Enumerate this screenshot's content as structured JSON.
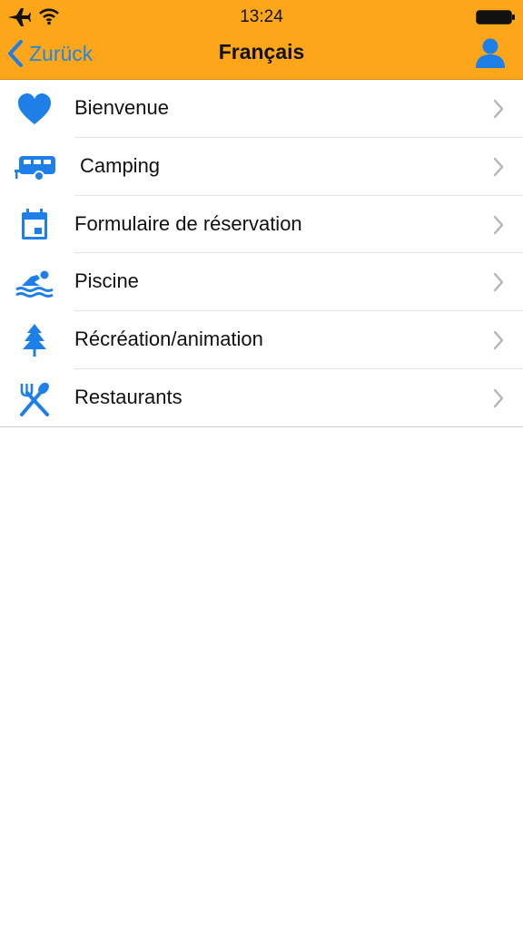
{
  "status_bar": {
    "time": "13:24",
    "icons": [
      "airplane-icon",
      "wifi-icon",
      "battery-icon"
    ]
  },
  "nav": {
    "back_label": "Zurück",
    "title": "Français",
    "right_icon": "person-icon"
  },
  "colors": {
    "header_bg": "#FDA61A",
    "accent_blue": "#1E7FE8",
    "text": "#111111",
    "separator": "#E3E3E3"
  },
  "menu": {
    "items": [
      {
        "label": "Bienvenue",
        "icon": "heart-icon"
      },
      {
        "label": "Camping",
        "icon": "caravan-icon"
      },
      {
        "label": "Formulaire de réservation",
        "icon": "calendar-icon"
      },
      {
        "label": "Piscine",
        "icon": "swimmer-icon"
      },
      {
        "label": "Récréation/animation",
        "icon": "tree-icon"
      },
      {
        "label": "Restaurants",
        "icon": "utensils-icon"
      }
    ]
  }
}
